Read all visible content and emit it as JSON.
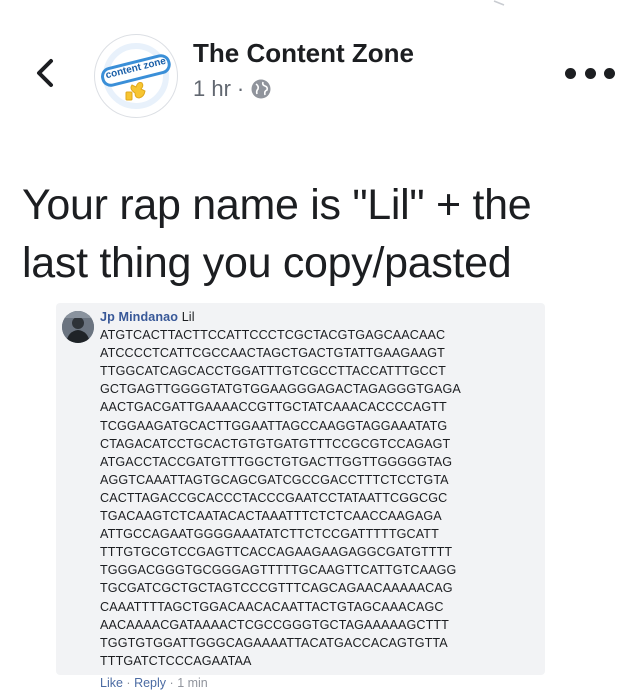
{
  "header": {
    "back_icon": "chevron-left-icon",
    "page_name": "The Content Zone",
    "avatar_text": "content zone",
    "timestamp": "1 hr",
    "separator": "·",
    "privacy_icon": "globe-icon",
    "more_icon": "more-dots-icon"
  },
  "post": {
    "text": "Your rap name is \"Lil\" + the\nlast thing you copy/pasted"
  },
  "comment": {
    "author": "Jp Mindanao",
    "first_word": "Lil",
    "lines": [
      "ATGTCACTTACTTCCATTCCCTCGCTACGTGAGCAACAAC",
      "ATCCCCTCATTCGCCAACTAGCTGACTGTATTGAAGAAGT",
      "TTGGCATCAGCACCTGGATTTGTCGCCTTACCATTTGCCT",
      "GCTGAGTTGGGGTATGTGGAAGGGAGACTAGAGGGTGAGA",
      "AACTGACGATTGAAAACCGTTGCTATCAAACACCCCAGTT",
      "TCGGAAGATGCACTTGGAATTAGCCAAGGTAGGAAATATG",
      "CTAGACATCCTGCACTGTGTGATGTTTCCGCGTCCAGAGT",
      "ATGACCTACCGATGTTTGGCTGTGACTTGGTTGGGGGTAG",
      "AGGTCAAATTAGTGCAGCGATCGCCGACCTTTCTCCTGTA",
      "CACTTAGACCGCACCCTACCCGAATCCTATAATTCGGCGC",
      "TGACAAGTCTCAATACACTAAATTTCTCTCAACCAAGAGA",
      "ATTGCCAGAATGGGGAAATATCTTCTCCGATTTTTGCATT",
      "TTTGTGCGTCCGAGTTCACCAGAAGAAGAGGCGATGTTTT",
      "TGGGACGGGTGCGGGAGTTTTTGCAAGTTCATTGTCAAGG",
      "TGCGATCGCTGCTAGTCCCGTTTCAGCAGAACAAAAACAG",
      "CAAATTTTAGCTGGACAACACAATTACTGTAGCAAACAGC",
      "AACAAAACGATAAAACTCGCCGGGTGCTAGAAAAAGCTTT",
      "TGGTGTGGATTGGGCAGAAAATTACATGACCACAGTGTTA",
      "TTTGATCTCCCAGAATAA"
    ],
    "like_label": "Like",
    "reply_label": "Reply",
    "dot": "·",
    "time": "1 min"
  },
  "colors": {
    "author_blue": "#385898",
    "comment_bg": "#f2f3f5",
    "meta_gray": "#616770",
    "logo_blue": "#3a8fd8",
    "logo_yellow": "#f7c531"
  }
}
